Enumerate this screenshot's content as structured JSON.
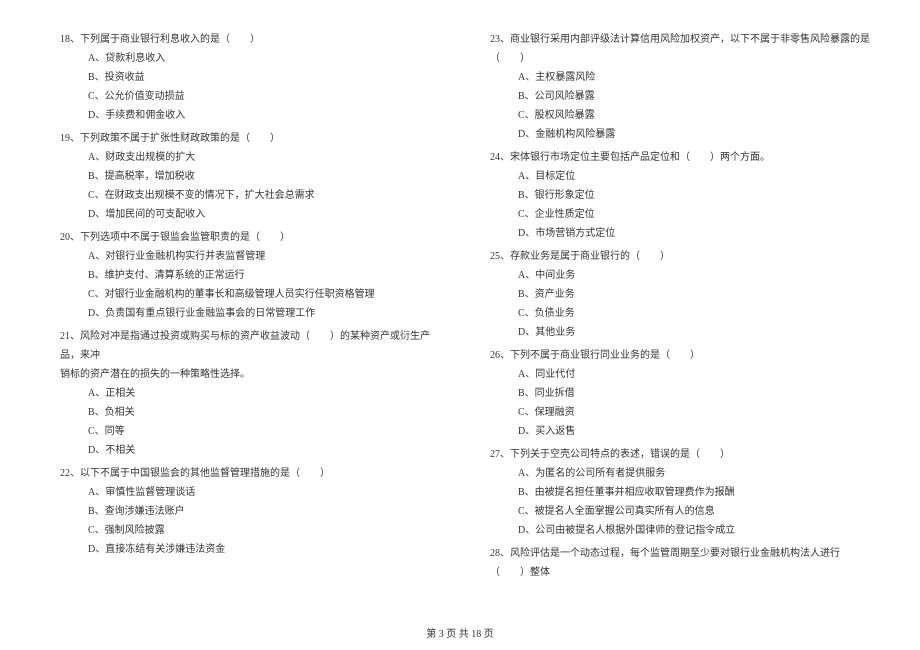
{
  "layout": {
    "pageNumber": "3",
    "totalPages": "18",
    "footerTemplate": "第 {current} 页 共 {total} 页"
  },
  "leftColumn": [
    {
      "num": "18",
      "stem": "下列属于商业银行利息收入的是（　　）",
      "options": [
        "A、贷款利息收入",
        "B、投资收益",
        "C、公允价值变动损益",
        "D、手续费和佣金收入"
      ]
    },
    {
      "num": "19",
      "stem": "下列政策不属于扩张性财政政策的是（　　）",
      "options": [
        "A、财政支出规模的扩大",
        "B、提高税率，增加税收",
        "C、在财政支出规模不变的情况下，扩大社会总需求",
        "D、增加民间的可支配收入"
      ]
    },
    {
      "num": "20",
      "stem": "下列选项中不属于银监会监管职责的是（　　）",
      "options": [
        "A、对银行业金融机构实行并表监督管理",
        "B、维护支付、清算系统的正常运行",
        "C、对银行业金融机构的董事长和高级管理人员实行任职资格管理",
        "D、负责国有重点银行业金融监事会的日常管理工作"
      ]
    },
    {
      "num": "21",
      "stem": "风险对冲是指通过投资或购买与标的资产收益波动（　　）的某种资产或衍生产品，来冲",
      "stemLine2": "销标的资产潜在的损失的一种策略性选择。",
      "options": [
        "A、正相关",
        "B、负相关",
        "C、同等",
        "D、不相关"
      ]
    },
    {
      "num": "22",
      "stem": "以下不属于中国银监会的其他监督管理措施的是（　　）",
      "options": [
        "A、审慎性监督管理谈话",
        "B、查询涉嫌违法账户",
        "C、强制风险披露",
        "D、直接冻结有关涉嫌违法资金"
      ]
    }
  ],
  "rightColumn": [
    {
      "num": "23",
      "stem": "商业银行采用内部评级法计算信用风险加权资产，以下不属于非零售风险暴露的是（　　）",
      "options": [
        "A、主权暴露风险",
        "B、公司风险暴露",
        "C、股权风险暴露",
        "D、金融机构风险暴露"
      ]
    },
    {
      "num": "24",
      "stem": "宋体银行市场定位主要包括产品定位和（　　）两个方面。",
      "options": [
        "A、目标定位",
        "B、银行形象定位",
        "C、企业性质定位",
        "D、市场营销方式定位"
      ]
    },
    {
      "num": "25",
      "stem": "存款业务是属于商业银行的（　　）",
      "options": [
        "A、中间业务",
        "B、资产业务",
        "C、负债业务",
        "D、其他业务"
      ]
    },
    {
      "num": "26",
      "stem": "下列不属于商业银行同业业务的是（　　）",
      "options": [
        "A、同业代付",
        "B、同业拆借",
        "C、保理融资",
        "D、买入返售"
      ]
    },
    {
      "num": "27",
      "stem": "下列关于空壳公司特点的表述，错误的是（　　）",
      "options": [
        "A、为匿名的公司所有者提供服务",
        "B、由被提名担任董事并相应收取管理费作为报酬",
        "C、被提名人全面掌握公司真实所有人的信息",
        "D、公司由被提名人根据外国律师的登记指令成立"
      ]
    },
    {
      "num": "28",
      "stem": "风险评估是一个动态过程，每个监管周期至少要对银行业金融机构法人进行（　　）整体",
      "options": []
    }
  ],
  "footer": "第 3 页 共 18 页"
}
